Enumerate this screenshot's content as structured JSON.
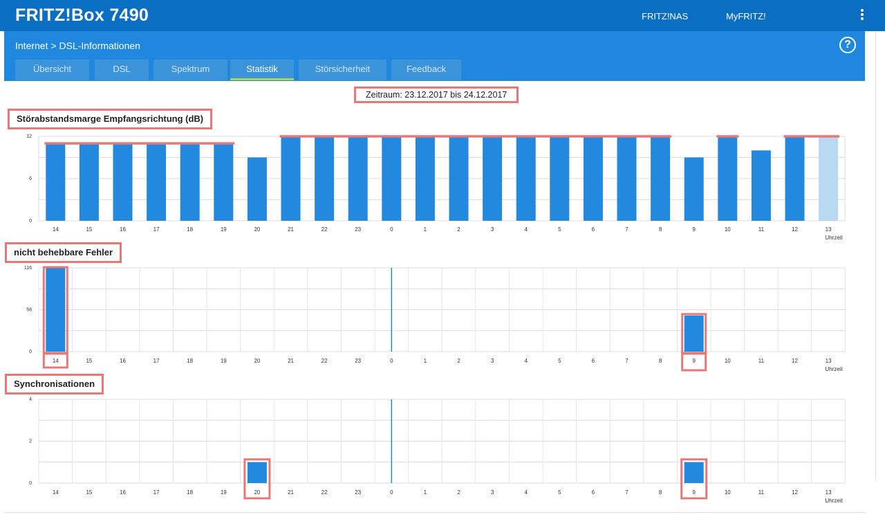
{
  "header": {
    "title": "FRITZ!Box 7490",
    "links": [
      "FRITZ!NAS",
      "MyFRITZ!"
    ]
  },
  "breadcrumb": {
    "parent": "Internet",
    "separator": ">",
    "current": "DSL-Informationen"
  },
  "help_icon": "help-circle-icon",
  "tabs": [
    {
      "label": "Übersicht",
      "active": false
    },
    {
      "label": "DSL",
      "active": false
    },
    {
      "label": "Spektrum",
      "active": false
    },
    {
      "label": "Statistik",
      "active": true
    },
    {
      "label": "Störsicherheit",
      "active": false
    },
    {
      "label": "Feedback",
      "active": false
    }
  ],
  "period": "Zeitraum: 23.12.2017 bis 24.12.2017",
  "colors": {
    "header": "#0a6fc2",
    "subheader": "#1f88de",
    "tab": "#3b93d9",
    "bar": "#2289de",
    "bar_light": "#b9d9f2",
    "highlight": "#e8777a",
    "active_tab_underline": "#aad55a"
  },
  "x_axis_label": "Uhrzeit",
  "chart_data": [
    {
      "type": "bar",
      "title": "Störabstandsmarge Empfangsrichtung (dB)",
      "categories": [
        "14",
        "15",
        "16",
        "17",
        "18",
        "19",
        "20",
        "21",
        "22",
        "23",
        "0",
        "1",
        "2",
        "3",
        "4",
        "5",
        "6",
        "7",
        "8",
        "9",
        "10",
        "11",
        "12",
        "13"
      ],
      "values": [
        11,
        11,
        11,
        11,
        11,
        11,
        9,
        12,
        12,
        12,
        12,
        12,
        12,
        12,
        12,
        12,
        12,
        12,
        12,
        9,
        12,
        10,
        12,
        12
      ],
      "y_ticks": [
        "0",
        "6",
        "12"
      ],
      "ylim": [
        0,
        12
      ]
    },
    {
      "type": "bar",
      "title": "nicht behebbare Fehler",
      "categories": [
        "14",
        "15",
        "16",
        "17",
        "18",
        "19",
        "20",
        "21",
        "22",
        "23",
        "0",
        "1",
        "2",
        "3",
        "4",
        "5",
        "6",
        "7",
        "8",
        "9",
        "10",
        "11",
        "12",
        "13"
      ],
      "values": [
        116,
        0,
        0,
        0,
        0,
        0,
        0,
        0,
        0,
        0,
        0,
        0,
        0,
        0,
        0,
        0,
        0,
        0,
        0,
        50,
        0,
        0,
        0,
        0
      ],
      "y_ticks": [
        "0",
        "58",
        "116"
      ],
      "ylim": [
        0,
        116
      ]
    },
    {
      "type": "bar",
      "title": "Synchronisationen",
      "categories": [
        "14",
        "15",
        "16",
        "17",
        "18",
        "19",
        "20",
        "21",
        "22",
        "23",
        "0",
        "1",
        "2",
        "3",
        "4",
        "5",
        "6",
        "7",
        "8",
        "9",
        "10",
        "11",
        "12",
        "13"
      ],
      "values": [
        0,
        0,
        0,
        0,
        0,
        0,
        1,
        0,
        0,
        0,
        0,
        0,
        0,
        0,
        0,
        0,
        0,
        0,
        0,
        1,
        0,
        0,
        0,
        0
      ],
      "y_ticks": [
        "0",
        "2",
        "4"
      ],
      "ylim": [
        0,
        4
      ]
    }
  ]
}
